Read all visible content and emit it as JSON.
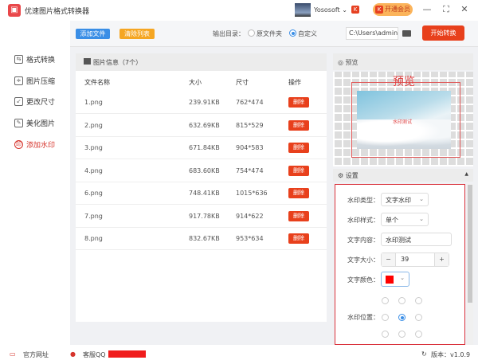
{
  "app": {
    "title": "优速图片格式转换器",
    "user": "Yososoft",
    "vip_label": "开通会员",
    "window_controls": [
      "minimize",
      "maximize",
      "close"
    ]
  },
  "toolbar": {
    "add_label": "添加文件",
    "clear_label": "清除列表",
    "output_label": "输出目录：",
    "radio_original": "原文件夹",
    "radio_custom": "自定义",
    "selected": "自定义",
    "path": "C:\\Users\\admin\\Deskto",
    "start_label": "开始转换"
  },
  "sidebar": {
    "items": [
      {
        "label": "格式转换",
        "icon": "convert-icon"
      },
      {
        "label": "图片压缩",
        "icon": "compress-icon"
      },
      {
        "label": "更改尺寸",
        "icon": "resize-icon"
      },
      {
        "label": "美化图片",
        "icon": "beautify-icon"
      },
      {
        "label": "添加水印",
        "icon": "watermark-icon",
        "active": true
      }
    ]
  },
  "table": {
    "title": "图片信息（7个）",
    "columns": [
      "文件名称",
      "大小",
      "尺寸",
      "操作"
    ],
    "delete_label": "删除",
    "rows": [
      {
        "name": "1.png",
        "size": "239.91KB",
        "dims": "762*474"
      },
      {
        "name": "2.png",
        "size": "632.69KB",
        "dims": "815*529"
      },
      {
        "name": "3.png",
        "size": "671.84KB",
        "dims": "904*583"
      },
      {
        "name": "4.png",
        "size": "683.60KB",
        "dims": "754*474"
      },
      {
        "name": "6.png",
        "size": "748.41KB",
        "dims": "1015*636"
      },
      {
        "name": "7.png",
        "size": "917.78KB",
        "dims": "914*622"
      },
      {
        "name": "8.png",
        "size": "832.67KB",
        "dims": "953*634"
      }
    ]
  },
  "preview": {
    "header": "预览",
    "overlay_label": "预览",
    "watermark_text": "水印测试"
  },
  "settings": {
    "header": "设置",
    "type_label": "水印类型：",
    "type_value": "文字水印",
    "style_label": "水印样式：",
    "style_value": "单个",
    "content_label": "文字内容：",
    "content_value": "水印测试",
    "size_label": "文字大小：",
    "size_value": "39",
    "color_label": "文字颜色：",
    "color_value": "#ff0000",
    "position_label": "水印位置：",
    "position_selected": "middle-center"
  },
  "footer": {
    "website": "官方网址",
    "support": "客服QQ",
    "version": "版本：v1.0.9"
  },
  "colors": {
    "accent": "#e8401c",
    "primary": "#3a8ee6",
    "highlight": "#d9303a"
  }
}
